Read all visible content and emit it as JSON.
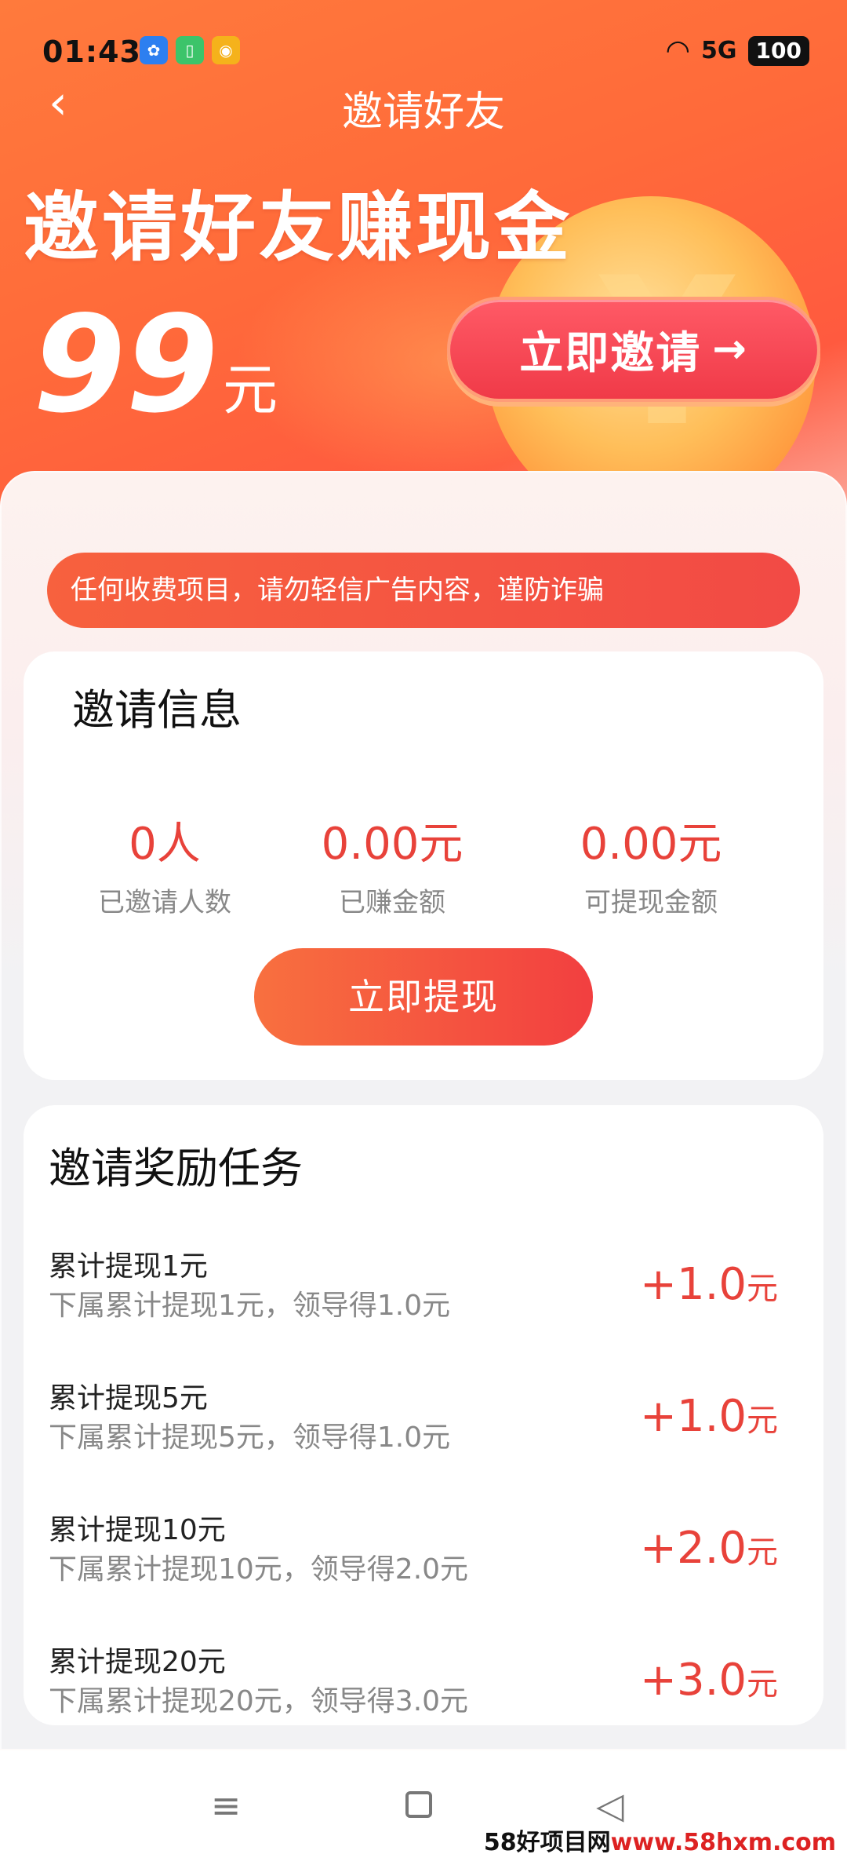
{
  "status_bar": {
    "time": "01:43",
    "signal": "5G",
    "battery": "100"
  },
  "header": {
    "title": "邀请好友",
    "back_icon": "chevron-left-icon"
  },
  "hero": {
    "headline": "邀请好友赚现金",
    "amount": "99",
    "unit": "元",
    "invite_button": "立即邀请",
    "invite_arrow": "→"
  },
  "notice": {
    "text": "任何收费项目，请勿轻信广告内容，谨防诈骗"
  },
  "invite_info": {
    "title": "邀请信息",
    "stats": [
      {
        "value": "0人",
        "label": "已邀请人数"
      },
      {
        "value": "0.00元",
        "label": "已赚金额"
      },
      {
        "value": "0.00元",
        "label": "可提现金额"
      }
    ],
    "withdraw_button": "立即提现"
  },
  "tasks": {
    "title": "邀请奖励任务",
    "items": [
      {
        "title": "累计提现1元",
        "desc": "下属累计提现1元，领导得1.0元",
        "reward": "+1.0",
        "unit": "元"
      },
      {
        "title": "累计提现5元",
        "desc": "下属累计提现5元，领导得1.0元",
        "reward": "+1.0",
        "unit": "元"
      },
      {
        "title": "累计提现10元",
        "desc": "下属累计提现10元，领导得2.0元",
        "reward": "+2.0",
        "unit": "元"
      },
      {
        "title": "累计提现20元",
        "desc": "下属累计提现20元，领导得3.0元",
        "reward": "+3.0",
        "unit": "元"
      }
    ]
  },
  "watermark": {
    "prefix": "58好项目网",
    "suffix": "www.58hxm.com"
  },
  "colors": {
    "accent": "#e8423a",
    "hero": "#ff6a3a",
    "button": "#f03a48"
  }
}
